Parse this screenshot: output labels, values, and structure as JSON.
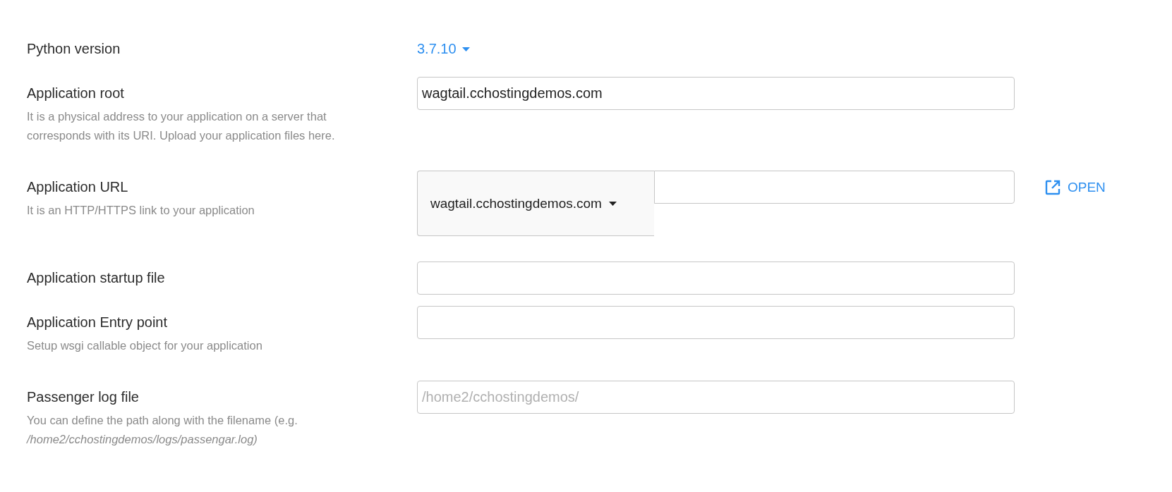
{
  "rows": [
    {
      "kind": "dropdown",
      "label": "Python version",
      "value": "3.7.10"
    },
    {
      "kind": "input",
      "label": "Application root",
      "value": "wagtail.cchostingdemos.com",
      "description": "It is a physical address to your application on a server that corresponds with its URI. Upload your application files here."
    },
    {
      "kind": "url",
      "label": "Application URL",
      "domain": "wagtail.cchostingdemos.com",
      "link": "OPEN",
      "description": "It is an HTTP/HTTPS link to your application"
    },
    {
      "kind": "input",
      "label": "Application startup file"
    },
    {
      "kind": "input",
      "label": "Application Entry point",
      "description": "Setup wsgi callable object for your application"
    },
    {
      "kind": "input",
      "label": "Passenger log file",
      "placeholder": "/home2/cchostingdemos/",
      "description": "You can define the path along with the filename (e.g. */home2/cchostingdemos/logs/passengar.log)*"
    }
  ]
}
